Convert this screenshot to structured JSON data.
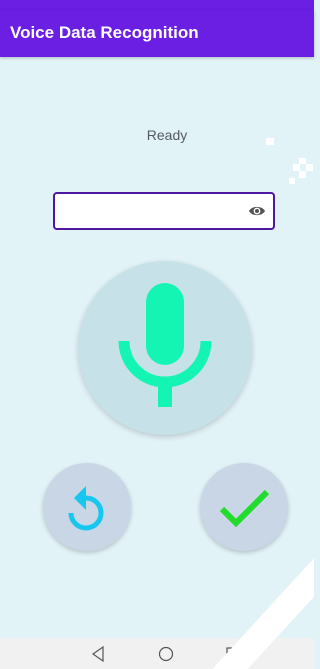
{
  "app_bar": {
    "title": "Voice Data Recognition"
  },
  "status": {
    "text": "Ready"
  },
  "input": {
    "value": "",
    "placeholder": "",
    "toggle_icon": "eye-icon"
  },
  "buttons": {
    "mic_icon": "microphone-icon",
    "reset_icon": "rotate-ccw-icon",
    "confirm_icon": "checkmark-icon"
  },
  "nav": {
    "back_icon": "triangle-back-icon",
    "home_icon": "circle-home-icon",
    "recents_icon": "square-recents-icon"
  },
  "colors": {
    "accent": "#6a1fe3",
    "background": "#e2f3f8",
    "mic": "#14f5b4",
    "reset": "#18c7f0",
    "confirm": "#21dc2d"
  }
}
